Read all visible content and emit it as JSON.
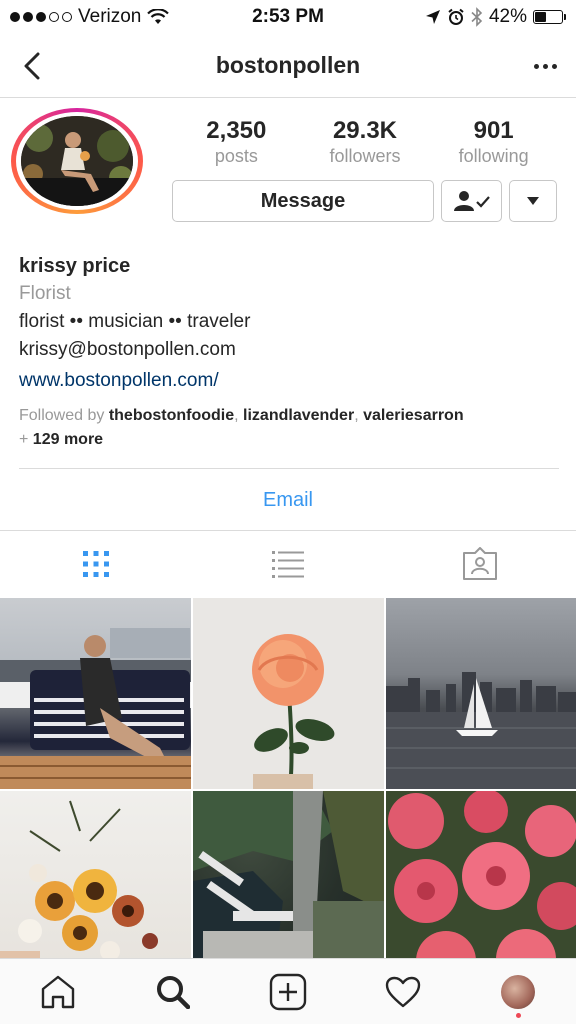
{
  "status_bar": {
    "carrier": "Verizon",
    "time": "2:53 PM",
    "battery": "42%",
    "battery_level": 0.42
  },
  "nav": {
    "title": "bostonpollen"
  },
  "stats": [
    {
      "value": "2,350",
      "label": "posts"
    },
    {
      "value": "29.3K",
      "label": "followers"
    },
    {
      "value": "901",
      "label": "following"
    }
  ],
  "actions": {
    "message_label": "Message"
  },
  "bio": {
    "name": "krissy price",
    "category": "Florist",
    "line1": "florist •• musician •• traveler",
    "line2": "krissy@bostonpollen.com",
    "website": "www.bostonpollen.com/",
    "followed_by_prefix": "Followed by",
    "followers": [
      "thebostonfoodie",
      "lizandlavender",
      "valeriesarron"
    ],
    "more_prefix": "+",
    "more": "129 more"
  },
  "contact": {
    "email_label": "Email"
  },
  "tabs": [
    "grid",
    "list",
    "tagged"
  ],
  "posts": [
    {
      "subject": "woman on boat"
    },
    {
      "subject": "peach rose"
    },
    {
      "subject": "sailboat skyline"
    },
    {
      "subject": "sunflower bouquet"
    },
    {
      "subject": "aerial harbor"
    },
    {
      "subject": "pink dahlias"
    }
  ],
  "colors": {
    "accent": "#3897f0",
    "link": "#003569",
    "text": "#262626",
    "muted": "#999999",
    "border": "#dbdbdb"
  }
}
